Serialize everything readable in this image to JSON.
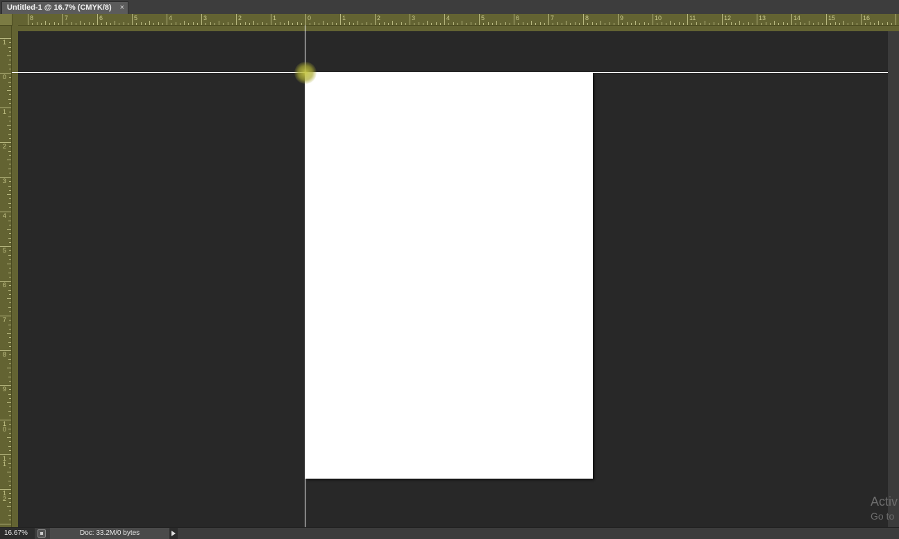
{
  "document_tab": {
    "title": "Untitled-1 @ 16.7% (CMYK/8)",
    "close_glyph": "×"
  },
  "rulers": {
    "color": "#636332",
    "horizontal_left_labels": [
      "8",
      "7",
      "6",
      "5",
      "4",
      "3",
      "2",
      "1"
    ],
    "horizontal_right_labels": [
      "0",
      "1",
      "2",
      "3",
      "4",
      "5",
      "6",
      "7",
      "8",
      "9",
      "10",
      "11",
      "12",
      "13",
      "14",
      "15",
      "16"
    ],
    "vertical_top_labels": [
      "1"
    ],
    "vertical_labels": [
      "0",
      "1",
      "2",
      "3",
      "4",
      "5",
      "6",
      "7",
      "8",
      "9",
      "10",
      "11",
      "12"
    ]
  },
  "canvas": {
    "background_color": "#282828",
    "document_color": "#ffffff",
    "guide_color": "#ffffff"
  },
  "status_bar": {
    "zoom": "16.67%",
    "doc_info": "Doc: 33.2M/0 bytes",
    "menu_icon": "triangle-right-icon"
  },
  "watermark": {
    "line1": "Activ",
    "line2": "Go to"
  }
}
